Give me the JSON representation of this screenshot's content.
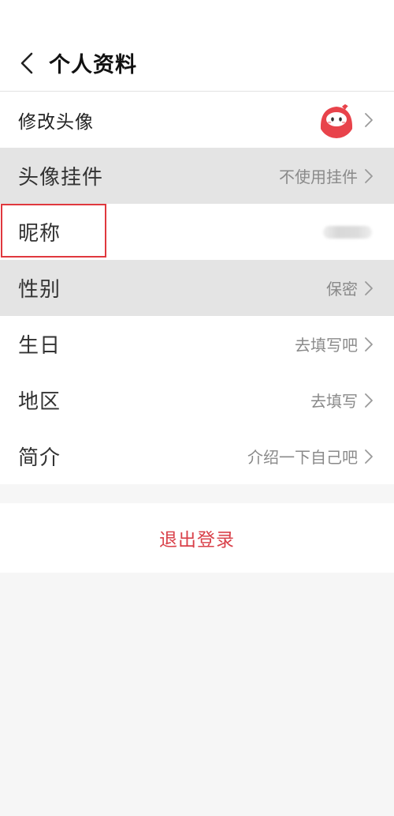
{
  "header": {
    "title": "个人资料"
  },
  "rows": {
    "avatar": {
      "label": "修改头像"
    },
    "pendant": {
      "label": "头像挂件",
      "value": "不使用挂件"
    },
    "nickname": {
      "label": "昵称"
    },
    "gender": {
      "label": "性别",
      "value": "保密"
    },
    "birthday": {
      "label": "生日",
      "value": "去填写吧"
    },
    "region": {
      "label": "地区",
      "value": "去填写"
    },
    "bio": {
      "label": "简介",
      "value": "介绍一下自己吧"
    }
  },
  "logout": {
    "label": "退出登录"
  },
  "colors": {
    "accent": "#d9414a",
    "highlight": "#e0383e",
    "shaded_row": "#e4e4e4",
    "avatar_red": "#e8434b"
  },
  "icons": {
    "back": "chevron-left-icon",
    "row_arrow": "chevron-right-icon"
  }
}
